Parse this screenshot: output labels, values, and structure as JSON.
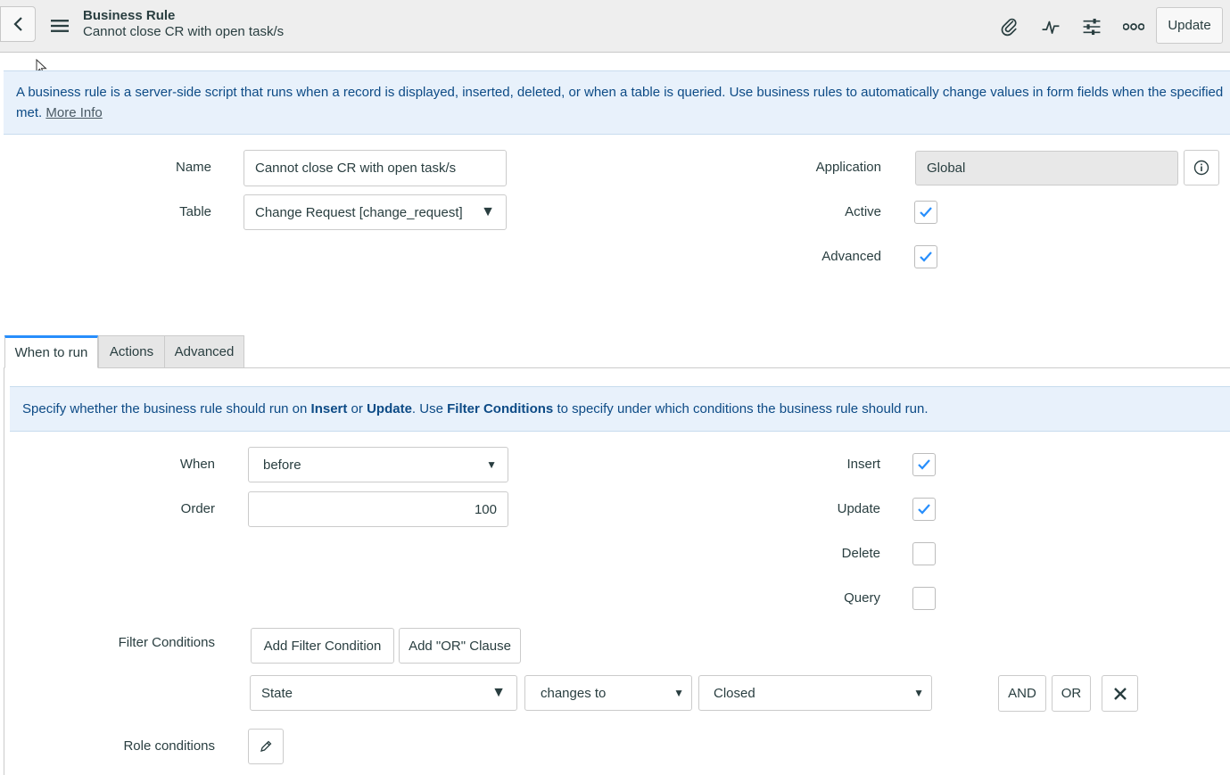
{
  "header": {
    "title": "Business Rule",
    "subtitle": "Cannot close CR with open task/s",
    "update_label": "Update"
  },
  "banner": {
    "text": "A business rule is a server-side script that runs when a record is displayed, inserted, deleted, or when a table is queried. Use business rules to automatically change values in form fields when the specified conditions are met.",
    "visible_text": "A business rule is a server-side script that runs when a record is displayed, inserted, deleted, or when a table is queried. Use business rules to automatically change values in form fields when the specified",
    "visible_text_line2": "met.",
    "more_info": "More Info"
  },
  "form": {
    "name_label": "Name",
    "name_value": "Cannot close CR with open task/s",
    "table_label": "Table",
    "table_value": "Change Request [change_request]",
    "application_label": "Application",
    "application_value": "Global",
    "active_label": "Active",
    "active_checked": true,
    "advanced_label": "Advanced",
    "advanced_checked": true
  },
  "tabs": [
    {
      "label": "When to run",
      "active": true
    },
    {
      "label": "Actions",
      "active": false
    },
    {
      "label": "Advanced",
      "active": false
    }
  ],
  "when_to_run": {
    "hint_pre": "Specify whether the business rule should run on ",
    "hint_insert": "Insert",
    "hint_or": " or ",
    "hint_update": "Update",
    "hint_mid": ". Use ",
    "hint_filter": "Filter Conditions",
    "hint_post": " to specify under which conditions the business rule should run.",
    "when_label": "When",
    "when_value": "before",
    "order_label": "Order",
    "order_value": "100",
    "insert_label": "Insert",
    "insert_checked": true,
    "update_label": "Update",
    "update_checked": true,
    "delete_label": "Delete",
    "delete_checked": false,
    "query_label": "Query",
    "query_checked": false,
    "filter_label": "Filter Conditions",
    "add_filter_label": "Add Filter Condition",
    "add_or_label": "Add \"OR\" Clause",
    "condition_field": "State",
    "condition_operator": "changes to",
    "condition_value": "Closed",
    "and_label": "AND",
    "or_label": "OR",
    "role_label": "Role conditions"
  },
  "colors": {
    "accent": "#278efc",
    "banner_bg": "#e8f1fb",
    "banner_text": "#0d4b86",
    "header_bg": "#eeeeee"
  }
}
